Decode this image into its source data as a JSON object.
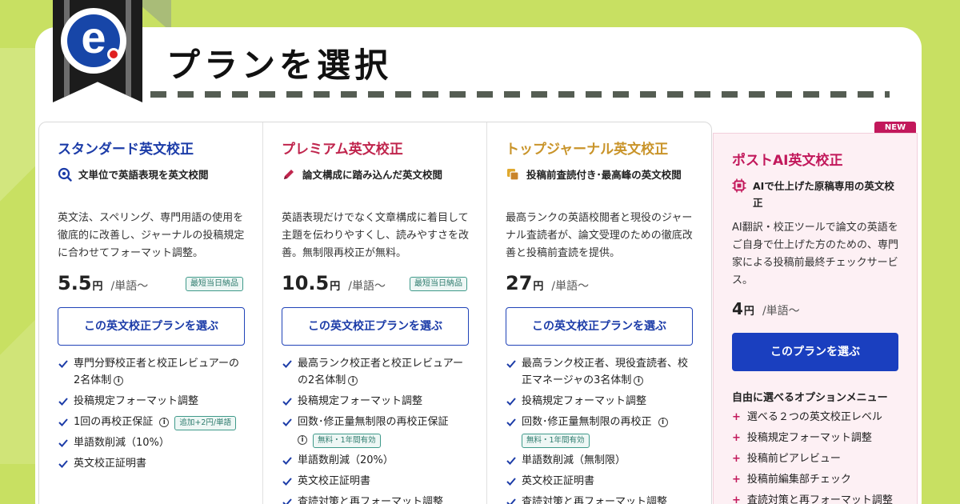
{
  "header": {
    "logo_letter": "e",
    "title": "プランを選択"
  },
  "colors": {
    "background": "#c8e062",
    "standard": "#1c3ca8",
    "premium": "#c0254d",
    "top_journal": "#c9942a",
    "post_ai": "#c2185b",
    "button_blue": "#1a3fbf"
  },
  "plans": [
    {
      "title": "スタンダード英文校正",
      "feature_icon": "magnifier-eye-icon",
      "feature": "文単位で英語表現を英文校閲",
      "description": "英文法、スペリング、専門用語の使用を徹底的に改善し、ジャーナルの投稿規定に合わせてフォーマット調整。",
      "price": "5.5",
      "unit": "円",
      "per": "/単語〜",
      "badge": "最短当日納品",
      "button": "この英文校正プランを選ぶ",
      "checks": [
        {
          "text": "専門分野校正者と校正レビュアーの2名体制",
          "info": true
        },
        {
          "text": "投稿規定フォーマット調整"
        },
        {
          "text": "1回の再校正保証",
          "info": true,
          "tag": "追加+2円/単語"
        },
        {
          "text": "単語数削減（10%）"
        },
        {
          "text": "英文校正証明書"
        }
      ]
    },
    {
      "title": "プレミアム英文校正",
      "feature_icon": "pencil-icon",
      "feature": "論文構成に踏み込んだ英文校閲",
      "description": "英語表現だけでなく文章構成に着目して主題を伝わりやすくし、読みやすさを改善。無制限再校正が無料。",
      "price": "10.5",
      "unit": "円",
      "per": "/単語〜",
      "badge": "最短当日納品",
      "button": "この英文校正プランを選ぶ",
      "checks": [
        {
          "text": "最高ランク校正者と校正レビュアーの2名体制",
          "info": true
        },
        {
          "text": "投稿規定フォーマット調整"
        },
        {
          "text": "回数･修正量無制限の再校正保証",
          "info": true,
          "tag": "無料・1年間有効"
        },
        {
          "text": "単語数削減（20%）"
        },
        {
          "text": "英文校正証明書"
        },
        {
          "text": "査読対策と再フォーマット調整"
        }
      ]
    },
    {
      "title": "トップジャーナル英文校正",
      "feature_icon": "documents-icon",
      "feature": "投稿前査読付き･最高峰の英文校閲",
      "description": "最高ランクの英語校閲者と現役のジャーナル査読者が、論文受理のための徹底改善と投稿前査読を提供。",
      "price": "27",
      "unit": "円",
      "per": "/単語〜",
      "button": "この英文校正プランを選ぶ",
      "checks": [
        {
          "text": "最高ランク校正者、現役査読者、校正マネージャの3名体制",
          "info": true
        },
        {
          "text": "投稿規定フォーマット調整"
        },
        {
          "text": "回数･修正量無制限の再校正",
          "info": true,
          "tag": "無料・1年間有効"
        },
        {
          "text": "単語数削減（無制限）"
        },
        {
          "text": "英文校正証明書"
        },
        {
          "text": "査読対策と再フォーマット調整"
        }
      ]
    }
  ],
  "post_ai": {
    "new_badge": "NEW",
    "title": "ポストAI英文校正",
    "feature_icon": "chip-icon",
    "feature": "AIで仕上げた原稿専用の英文校正",
    "description": "AI翻訳・校正ツールで論文の英語をご自身で仕上げた方のための、専門家による投稿前最終チェックサービス。",
    "price": "4",
    "unit": "円",
    "per": "/単語〜",
    "button": "このプランを選ぶ",
    "options_title": "自由に選べるオプションメニュー",
    "options": [
      "選べる２つの英文校正レベル",
      "投稿規定フォーマット調整",
      "投稿前ピアレビュー",
      "投稿前編集部チェック",
      "査読対策と再フォーマット調整"
    ]
  }
}
